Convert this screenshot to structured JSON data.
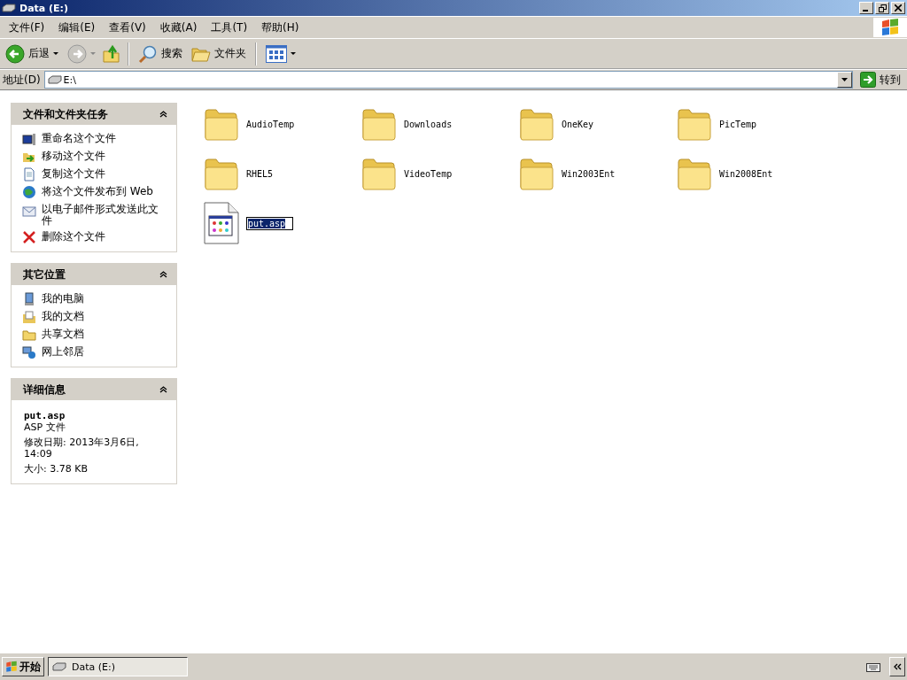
{
  "window": {
    "title": "Data (E:)"
  },
  "menu": [
    "文件(F)",
    "编辑(E)",
    "查看(V)",
    "收藏(A)",
    "工具(T)",
    "帮助(H)"
  ],
  "toolbar": {
    "back": "后退",
    "search": "搜索",
    "folders": "文件夹"
  },
  "address": {
    "label": "地址(D)",
    "value": "E:\\",
    "go": "转到"
  },
  "panels": [
    {
      "title": "文件和文件夹任务",
      "expanded": true,
      "items": [
        "重命名这个文件",
        "移动这个文件",
        "复制这个文件",
        "将这个文件发布到 Web",
        "以电子邮件形式发送此文件",
        "删除这个文件"
      ]
    },
    {
      "title": "其它位置",
      "expanded": true,
      "items": [
        "我的电脑",
        "我的文档",
        "共享文档",
        "网上邻居"
      ]
    }
  ],
  "details": {
    "title": "详细信息",
    "expanded": true,
    "name": "put.asp",
    "type": "ASP 文件",
    "modified": "修改日期: 2013年3月6日, 14:09",
    "size": "大小: 3.78 KB"
  },
  "files": [
    {
      "name": "AudioTemp",
      "kind": "folder",
      "editing": false
    },
    {
      "name": "Downloads",
      "kind": "folder",
      "editing": false
    },
    {
      "name": "OneKey",
      "kind": "folder",
      "editing": false
    },
    {
      "name": "PicTemp",
      "kind": "folder",
      "editing": false
    },
    {
      "name": "RHEL5",
      "kind": "folder",
      "editing": false
    },
    {
      "name": "VideoTemp",
      "kind": "folder",
      "editing": false
    },
    {
      "name": "Win2003Ent",
      "kind": "folder",
      "editing": false
    },
    {
      "name": "Win2008Ent",
      "kind": "folder",
      "editing": false
    },
    {
      "name": "put.asp",
      "kind": "file",
      "editing": true
    }
  ],
  "taskbar": {
    "start": "开始",
    "tasks": [
      {
        "label": "Data (E:)",
        "selected": true
      }
    ]
  }
}
